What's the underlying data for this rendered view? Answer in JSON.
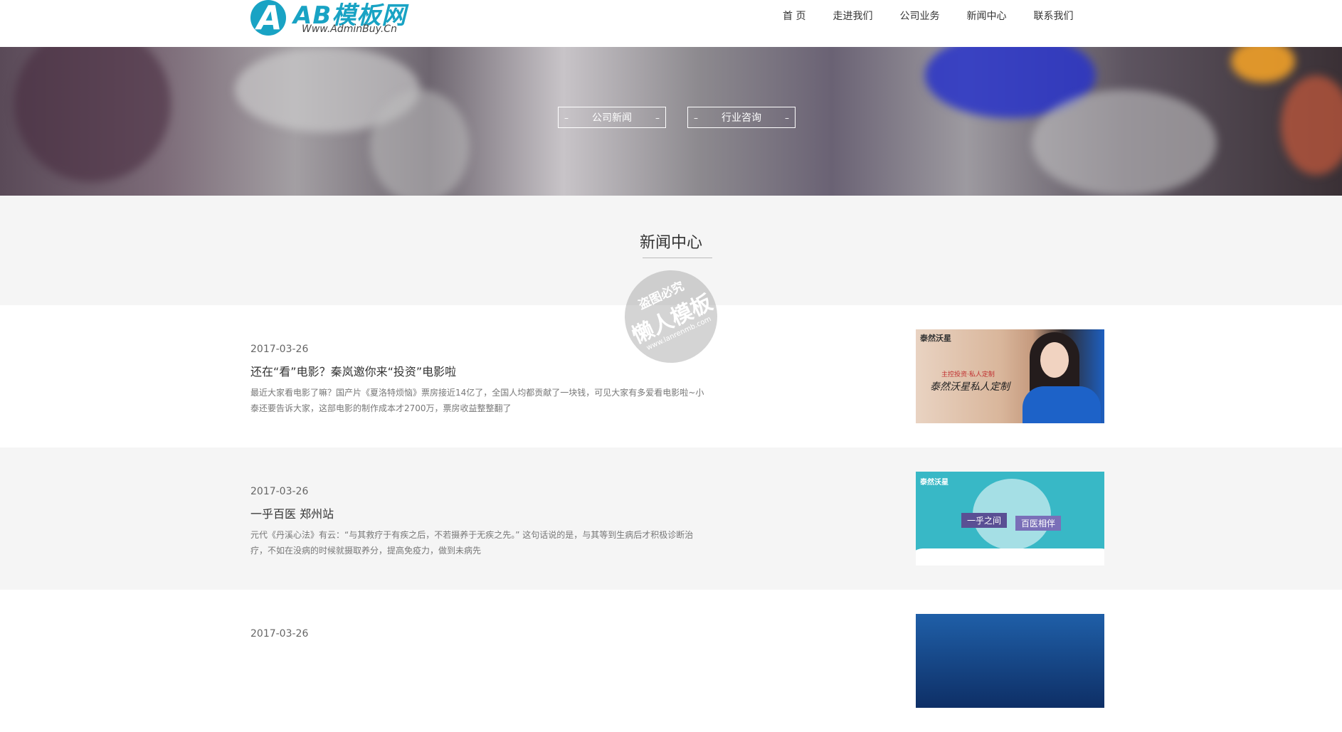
{
  "logo": {
    "mark": "A",
    "title": "AB模板网",
    "subtitle": "Www.AdminBuy.Cn"
  },
  "nav": {
    "items": [
      "首  页",
      "走进我们",
      "公司业务",
      "新闻中心",
      "联系我们"
    ]
  },
  "banner": {
    "buttons": [
      "公司新闻",
      "行业咨询"
    ],
    "dash": "–"
  },
  "section": {
    "title": "新闻中心"
  },
  "watermark": {
    "line1": "盗图必究",
    "line2": "懒人模板",
    "line3": "www.lanrenmb.com"
  },
  "news": [
    {
      "date": "2017-03-26",
      "title": "还在“看”电影？秦岚邀你来“投资”电影啦",
      "desc": "最近大家看电影了嘛？国产片《夏洛特烦恼》票房接近14亿了，全国人均都贡献了一块钱，可见大家有多爱看电影啦~小泰还要告诉大家，这部电影的制作成本才2700万，票房收益整整翻了",
      "thumb": {
        "brand": "泰然沃星",
        "tag": "主控投资·私人定制",
        "slogan": "泰然沃星私人定制"
      }
    },
    {
      "date": "2017-03-26",
      "title": "一乎百医 郑州站",
      "desc": "元代《丹溪心法》有云：“与其救疗于有疾之后，不若摄养于无疾之先。” 这句话说的是，与其等到生病后才积极诊断治疗，不如在没病的时候就摄取养分，提高免疫力，做到未病先",
      "thumb": {
        "brand": "泰然沃星",
        "banner_left": "一乎之间",
        "banner_right": "百医相伴"
      }
    },
    {
      "date": "2017-03-26"
    }
  ],
  "colors": {
    "accent": "#19a3c4",
    "section_bg": "#f5f5f5"
  }
}
